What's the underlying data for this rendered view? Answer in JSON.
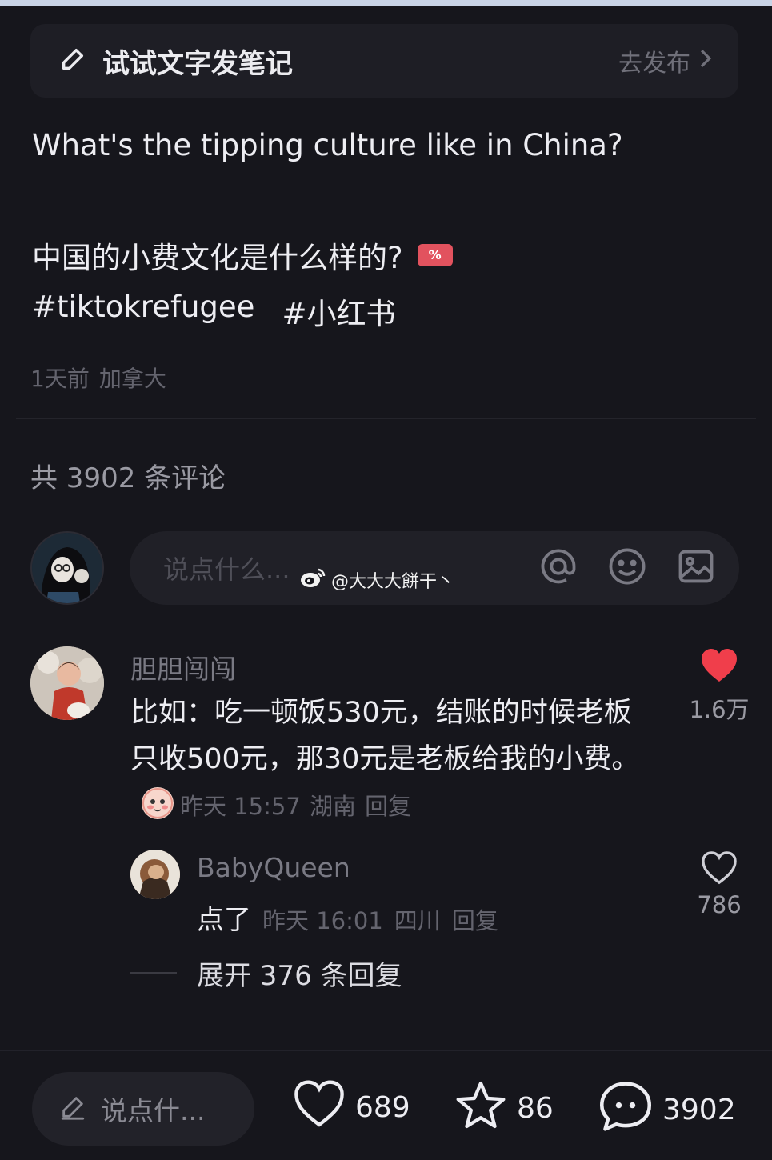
{
  "draft": {
    "title": "试试文字发笔记",
    "action": "去发布"
  },
  "post": {
    "text_en": "What's the tipping culture like in China?",
    "text_zh": "中国的小费文化是什么样的?",
    "hashtags": [
      "#tiktokrefugee",
      "#小红书"
    ],
    "time": "1天前",
    "location": "加拿大"
  },
  "comments_header": "共 3902 条评论",
  "input": {
    "placeholder": "说点什么..."
  },
  "watermark": "@大大大餅干丶",
  "comments": [
    {
      "user": "胆胆闯闯",
      "text": "比如：吃一顿饭530元，结账的时候老板只收500元，那30元是老板给我的小费。",
      "time": "昨天 15:57",
      "location": "湖南",
      "reply": "回复",
      "likes": "1.6万",
      "liked": true
    },
    {
      "user": "BabyQueen",
      "text": "点了",
      "time": "昨天 16:01",
      "location": "四川",
      "reply": "回复",
      "likes": "786",
      "liked": false
    }
  ],
  "expand_replies": "展开 376 条回复",
  "bottom": {
    "input_placeholder": "说点什...",
    "likes": "689",
    "favorites": "86",
    "comments": "3902"
  },
  "colors": {
    "background": "#16161c",
    "like_red": "#f03e4b",
    "muted_text": "#64646e"
  }
}
